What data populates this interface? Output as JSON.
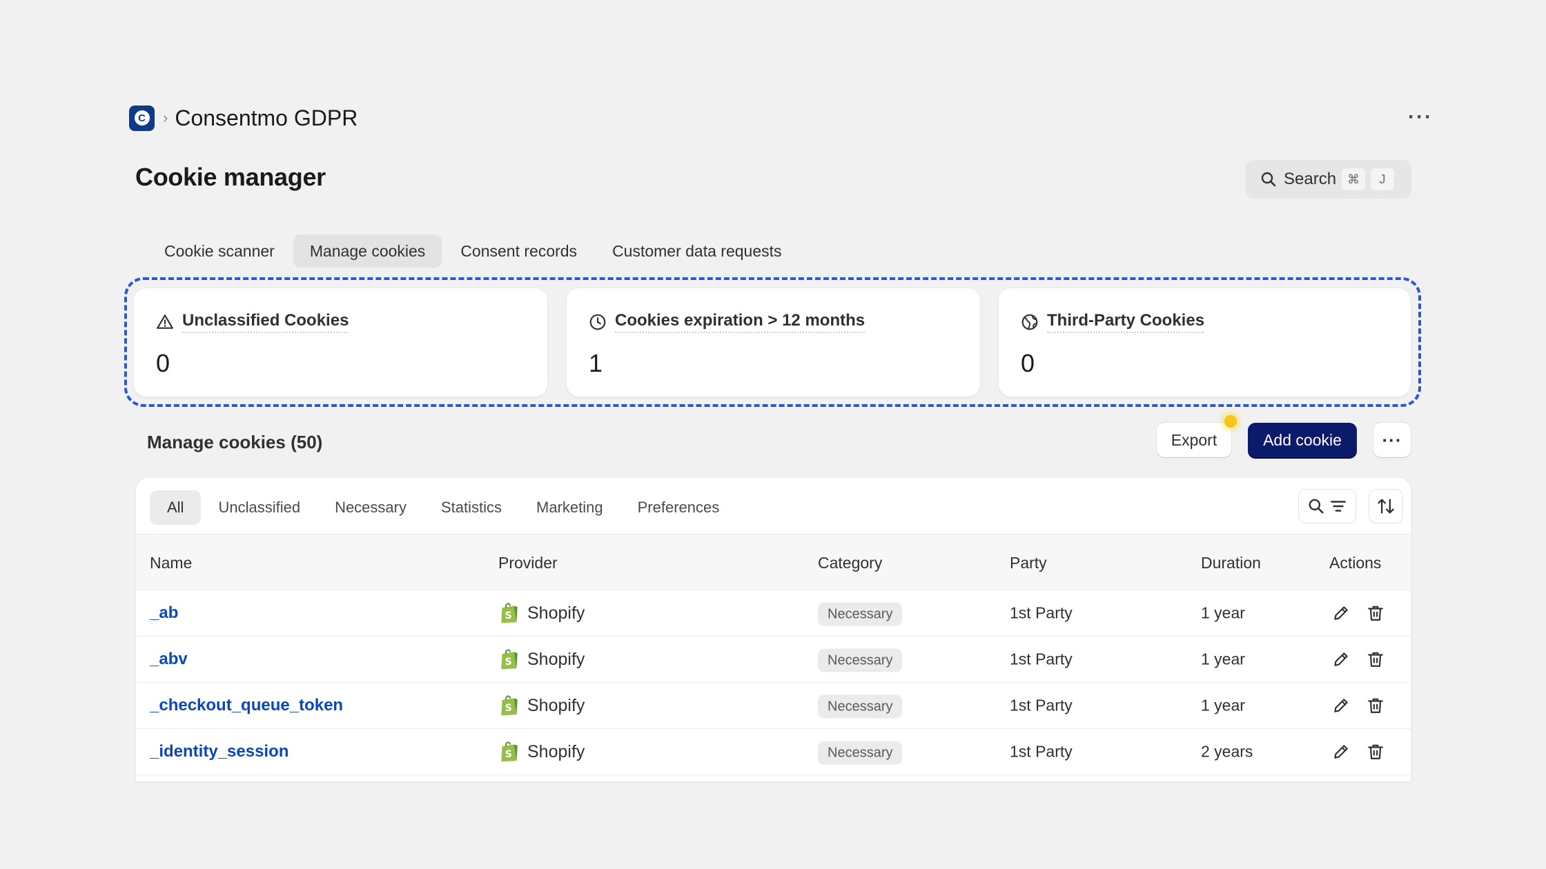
{
  "header": {
    "app_icon_glyph": "C",
    "breadcrumb_separator": "›",
    "app_name": "Consentmo GDPR",
    "more_label": "···"
  },
  "page_title": "Cookie manager",
  "search": {
    "label": "Search",
    "shortcut_key1": "⌘",
    "shortcut_key2": "J"
  },
  "tabs": [
    {
      "label": "Cookie scanner",
      "active": false
    },
    {
      "label": "Manage cookies",
      "active": true
    },
    {
      "label": "Consent records",
      "active": false
    },
    {
      "label": "Customer data requests",
      "active": false
    }
  ],
  "stats": [
    {
      "icon": "warning-icon",
      "label": "Unclassified Cookies",
      "value": "0"
    },
    {
      "icon": "clock-icon",
      "label": "Cookies expiration > 12 months",
      "value": "1"
    },
    {
      "icon": "globe-icon",
      "label": "Third-Party Cookies",
      "value": "0"
    }
  ],
  "section": {
    "title": "Manage cookies (50)",
    "export_label": "Export",
    "add_label": "Add cookie",
    "more_label": "···"
  },
  "filters": [
    {
      "label": "All",
      "active": true
    },
    {
      "label": "Unclassified",
      "active": false
    },
    {
      "label": "Necessary",
      "active": false
    },
    {
      "label": "Statistics",
      "active": false
    },
    {
      "label": "Marketing",
      "active": false
    },
    {
      "label": "Preferences",
      "active": false
    }
  ],
  "table": {
    "columns": [
      "Name",
      "Provider",
      "Category",
      "Party",
      "Duration",
      "Actions"
    ],
    "rows": [
      {
        "name": "_ab",
        "provider": "Shopify",
        "category": "Necessary",
        "party": "1st Party",
        "duration": "1 year"
      },
      {
        "name": "_abv",
        "provider": "Shopify",
        "category": "Necessary",
        "party": "1st Party",
        "duration": "1 year"
      },
      {
        "name": "_checkout_queue_token",
        "provider": "Shopify",
        "category": "Necessary",
        "party": "1st Party",
        "duration": "1 year"
      },
      {
        "name": "_identity_session",
        "provider": "Shopify",
        "category": "Necessary",
        "party": "1st Party",
        "duration": "2 years"
      }
    ]
  },
  "colors": {
    "accent": "#0b1a6b",
    "link": "#0b47b5",
    "highlight_frame": "#2a57d4",
    "app_icon": "#0e3a8c",
    "shopify_green": "#95bf47"
  }
}
